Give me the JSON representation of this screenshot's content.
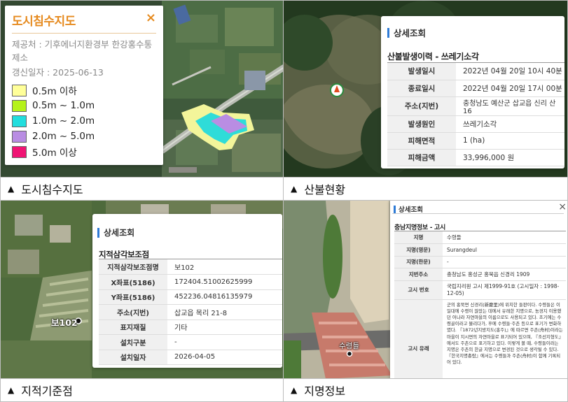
{
  "panels": {
    "flood": {
      "caption": "도시침수지도",
      "legend": {
        "title": "도시침수지도",
        "close_icon": "×",
        "source": "제공처 : 기후에너지환경부 한강홍수통제소",
        "updated": "갱신일자 : 2025-06-13",
        "items": [
          {
            "label": "0.5m 이하",
            "color": "#ffff99"
          },
          {
            "label": "0.5m ~ 1.0m",
            "color": "#b5f21a"
          },
          {
            "label": "1.0m ~ 2.0m",
            "color": "#22dede"
          },
          {
            "label": "2.0m ~ 5.0m",
            "color": "#b98de3"
          },
          {
            "label": "5.0m 이상",
            "color": "#f01474"
          }
        ]
      }
    },
    "fire": {
      "caption": "산불현황",
      "title": "상세조회",
      "subtitle": "산불발생이력 - 쓰레기소각",
      "rows": [
        {
          "k": "발생일시",
          "v": "2022년 04월 20일 10시 40분"
        },
        {
          "k": "종료일시",
          "v": "2022년 04월 20일 17시 00분"
        },
        {
          "k": "주소(지번)",
          "v": "충청남도 예산군 삽교읍 신리 산16"
        },
        {
          "k": "발생원인",
          "v": "쓰레기소각"
        },
        {
          "k": "피해면적",
          "v": "1 (ha)"
        },
        {
          "k": "피해금액",
          "v": "33,996,000 원"
        }
      ]
    },
    "survey": {
      "caption": "지적기준점",
      "title": "상세조회",
      "subtitle": "지적삼각보조점",
      "marker_label": "보102",
      "rows": [
        {
          "k": "지적삼각보조점명",
          "v": "보102"
        },
        {
          "k": "X좌표(5186)",
          "v": "172404.51002625999"
        },
        {
          "k": "Y좌표(5186)",
          "v": "452236.04816135979"
        },
        {
          "k": "주소(지번)",
          "v": "삽교읍 목리 21-8"
        },
        {
          "k": "표지재질",
          "v": "기타"
        },
        {
          "k": "설치구분",
          "v": "-"
        },
        {
          "k": "설치일자",
          "v": "2026-04-05"
        }
      ]
    },
    "place": {
      "caption": "지명정보",
      "title": "상세조회",
      "close_icon": "×",
      "subtitle": "충남지명정보 - 고시",
      "marker_label": "수령들",
      "rows": [
        {
          "k": "지명",
          "v": "수령들"
        },
        {
          "k": "지명(영문)",
          "v": "Surangdeul"
        },
        {
          "k": "지명(한문)",
          "v": "-"
        },
        {
          "k": "지번주소",
          "v": "충청남도 홍성군 홍북읍 신경리 1909"
        },
        {
          "k": "고시 번호",
          "v": "국립지리원 고시 제1999-91호 (고시일자 : 1998-12-05)"
        },
        {
          "k": "고시 유래",
          "v": "군의 홍북면 신경리(新慶里)에 위치한 들판이다. 수령들은 이 일대에 수령이 많았는 데에서 유래한 지명으로, 농경지 이용했던 어나라 자연마을의 이름으로도 사용되고 있다. 초기에는 수령골이라고 불리다가, 후에 수령들·주촌 등으로 표기가 변화하였다. 『1872년지방지도(홍주)』에 따르면 주촌(舟村)이라는 마을이 지시면의 자연마을로 표기되어 있으며, 『조선지형도』에서도 주촌으로 표기하고 있다. 이렇게 볼 때, 수령들이라는 지명은 주촌의 한글 지명으로 변경된 것으로 생각될 수 있다. 『한국지명총람』에서는 수령들과 주촌(舟村)이 함께 기록되어 있다."
        }
      ]
    }
  }
}
